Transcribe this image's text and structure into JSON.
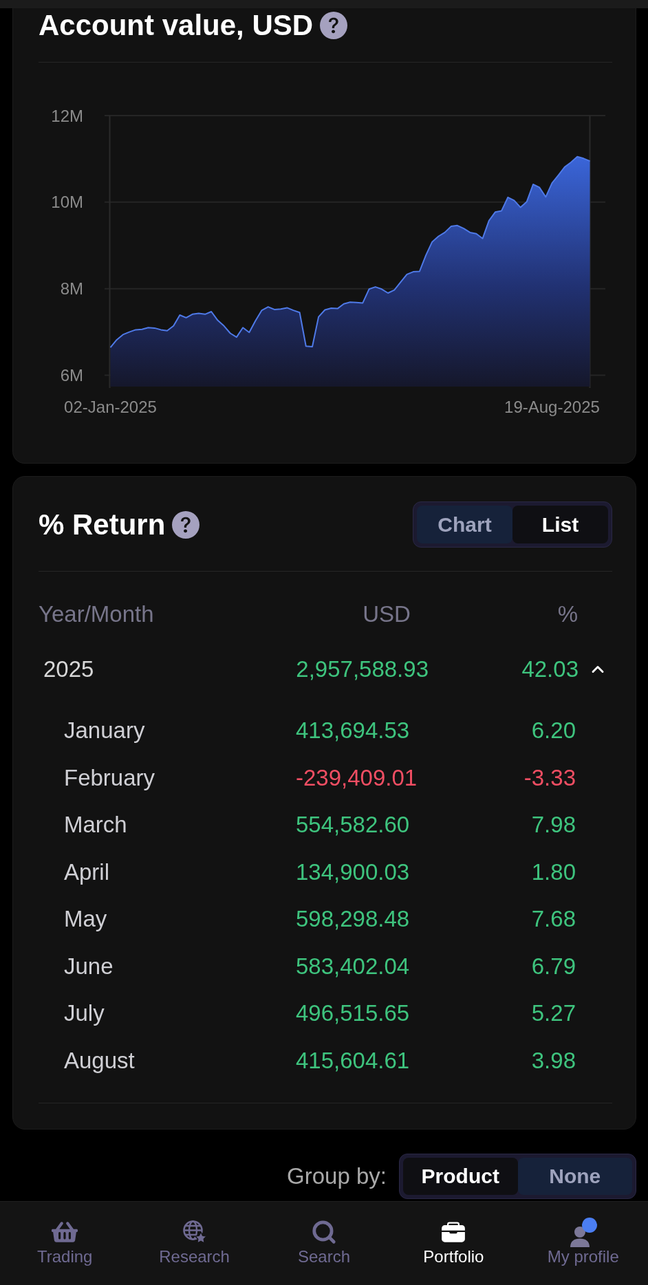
{
  "account_value": {
    "title": "Account value, USD",
    "chart_data": {
      "type": "area",
      "categories": [
        "02-Jan-2025",
        null,
        null,
        null,
        null,
        null,
        null,
        null,
        null,
        null,
        null,
        null,
        null,
        null,
        null,
        null,
        null,
        null,
        null,
        null,
        null,
        null,
        null,
        null,
        null,
        null,
        null,
        null,
        null,
        null,
        null,
        null,
        null,
        null,
        null,
        null,
        null,
        null,
        null,
        null,
        null,
        null,
        null,
        null,
        null,
        null,
        null,
        null,
        null,
        null,
        null,
        null,
        null,
        null,
        null,
        null,
        null,
        null,
        null,
        null,
        null,
        null,
        null,
        null,
        null,
        null,
        null,
        null,
        null,
        null,
        "19-Aug-2025",
        null,
        null,
        null,
        null,
        null,
        null
      ],
      "values": [
        6640000,
        6820000,
        6940000,
        7000000,
        7050000,
        7060000,
        7100000,
        7090000,
        7050000,
        7030000,
        7140000,
        7390000,
        7330000,
        7410000,
        7430000,
        7410000,
        7470000,
        7270000,
        7140000,
        6970000,
        6880000,
        7100000,
        6990000,
        7260000,
        7500000,
        7580000,
        7520000,
        7530000,
        7560000,
        7500000,
        7450000,
        6670000,
        6660000,
        7350000,
        7510000,
        7550000,
        7540000,
        7650000,
        7690000,
        7680000,
        7670000,
        7990000,
        8040000,
        7990000,
        7900000,
        7970000,
        8150000,
        8330000,
        8390000,
        8400000,
        8770000,
        9080000,
        9210000,
        9300000,
        9440000,
        9460000,
        9390000,
        9300000,
        9270000,
        9160000,
        9570000,
        9770000,
        9800000,
        10110000,
        10040000,
        9880000,
        10010000,
        10410000,
        10340000,
        10120000,
        10440000,
        10620000,
        10810000,
        10920000,
        11050000,
        11010000,
        10950000
      ],
      "ylim": [
        6000000,
        12000000
      ],
      "yticks": [
        {
          "value": 6000000,
          "label": "6M"
        },
        {
          "value": 8000000,
          "label": "8M"
        },
        {
          "value": 10000000,
          "label": "10M"
        },
        {
          "value": 12000000,
          "label": "12M"
        }
      ],
      "grid": true
    }
  },
  "return": {
    "title": "% Return",
    "view_toggle": [
      {
        "label": "Chart",
        "selected": false
      },
      {
        "label": "List",
        "selected": true
      }
    ],
    "table": {
      "columns": [
        "Year/Month",
        "USD",
        "%"
      ],
      "rows": [
        {
          "label": "2025",
          "usd": "2,957,588.93",
          "percent": "42.03",
          "color": "#3ec47e",
          "expanded": true,
          "children": [
            {
              "label": "January",
              "usd": "413,694.53",
              "percent": "6.20",
              "color": "#3ec47e"
            },
            {
              "label": "February",
              "usd": "-239,409.01",
              "percent": "-3.33",
              "color": "#f04e63"
            },
            {
              "label": "March",
              "usd": "554,582.60",
              "percent": "7.98",
              "color": "#3ec47e"
            },
            {
              "label": "April",
              "usd": "134,900.03",
              "percent": "1.80",
              "color": "#3ec47e"
            },
            {
              "label": "May",
              "usd": "598,298.48",
              "percent": "7.68",
              "color": "#3ec47e"
            },
            {
              "label": "June",
              "usd": "583,402.04",
              "percent": "6.79",
              "color": "#3ec47e"
            },
            {
              "label": "July",
              "usd": "496,515.65",
              "percent": "5.27",
              "color": "#3ec47e"
            },
            {
              "label": "August",
              "usd": "415,604.61",
              "percent": "3.98",
              "color": "#3ec47e"
            }
          ]
        }
      ]
    }
  },
  "group_by": {
    "label": "Group by:",
    "options": [
      {
        "label": "Product",
        "selected": true
      },
      {
        "label": "None",
        "selected": false
      }
    ]
  },
  "bottom_nav": [
    {
      "label": "Trading",
      "selected": false
    },
    {
      "label": "Research",
      "selected": false
    },
    {
      "label": "Search",
      "selected": false
    },
    {
      "label": "Portfolio",
      "selected": true
    },
    {
      "label": "My profile",
      "selected": false
    }
  ]
}
